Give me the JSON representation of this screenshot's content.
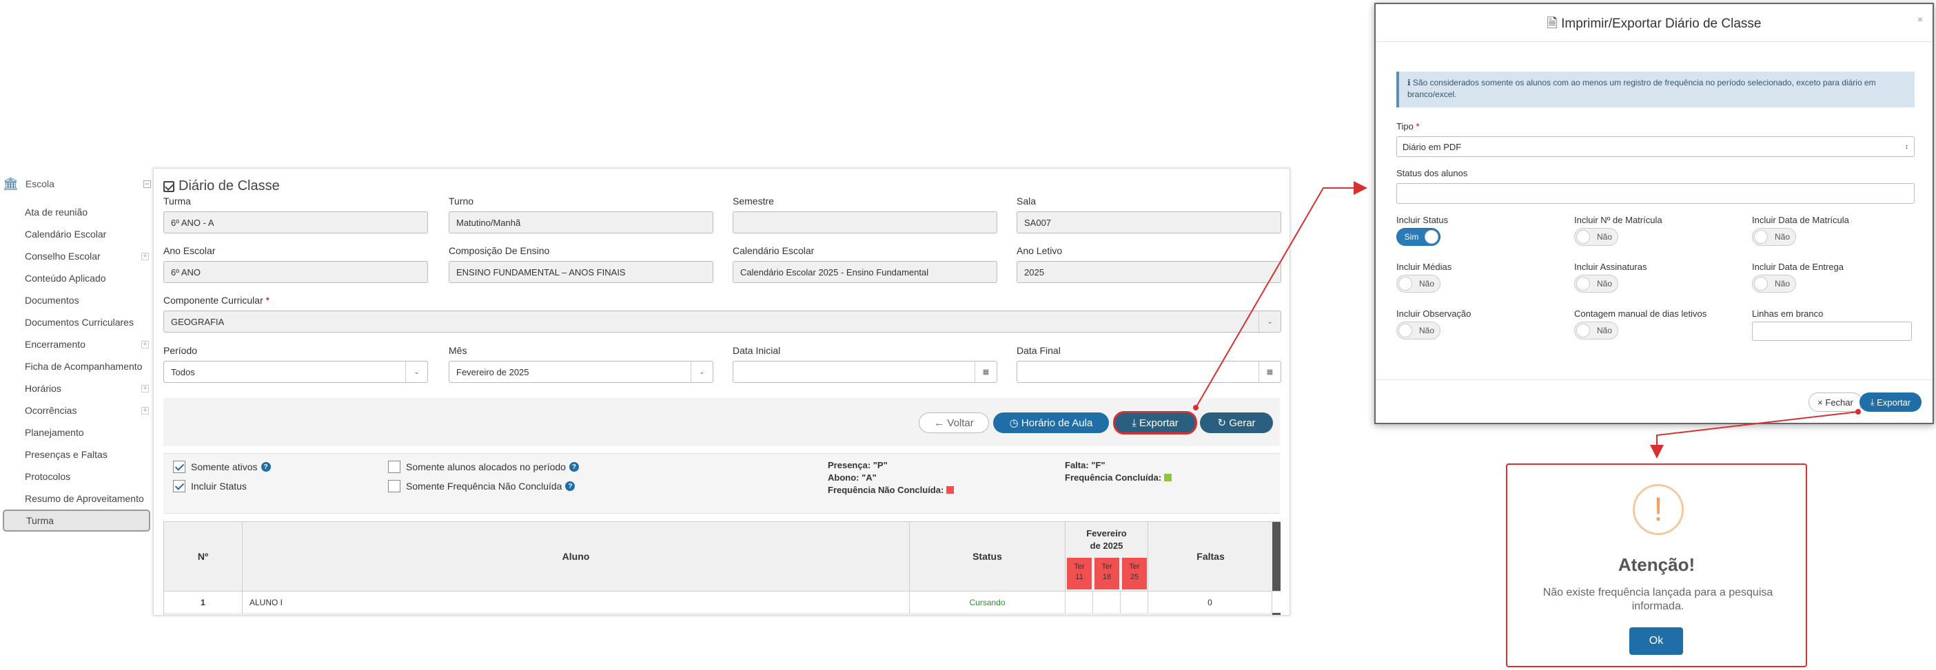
{
  "sidebar": {
    "header": "Escola",
    "items": [
      {
        "label": "Ata de reunião",
        "expandable": false
      },
      {
        "label": "Calendário Escolar",
        "expandable": false
      },
      {
        "label": "Conselho Escolar",
        "expandable": true
      },
      {
        "label": "Conteúdo Aplicado",
        "expandable": false
      },
      {
        "label": "Documentos",
        "expandable": false
      },
      {
        "label": "Documentos Curriculares",
        "expandable": false
      },
      {
        "label": "Encerramento",
        "expandable": true
      },
      {
        "label": "Ficha de Acompanhamento",
        "expandable": false
      },
      {
        "label": "Horários",
        "expandable": true
      },
      {
        "label": "Ocorrências",
        "expandable": true
      },
      {
        "label": "Planejamento",
        "expandable": false
      },
      {
        "label": "Presenças e Faltas",
        "expandable": false
      },
      {
        "label": "Protocolos",
        "expandable": false
      },
      {
        "label": "Resumo de Aproveitamento",
        "expandable": false
      },
      {
        "label": "Turma",
        "expandable": false,
        "active": true
      }
    ]
  },
  "panel": {
    "title": "Diário de Classe",
    "fields": {
      "turma": {
        "label": "Turma",
        "value": "6º ANO - A"
      },
      "turno": {
        "label": "Turno",
        "value": "Matutino/Manhã"
      },
      "semestre": {
        "label": "Semestre",
        "value": ""
      },
      "sala": {
        "label": "Sala",
        "value": "SA007"
      },
      "ano_escolar": {
        "label": "Ano Escolar",
        "value": "6º ANO"
      },
      "composicao": {
        "label": "Composição De Ensino",
        "value": "ENSINO FUNDAMENTAL – ANOS FINAIS"
      },
      "calendario": {
        "label": "Calendário Escolar",
        "value": "Calendário Escolar 2025 - Ensino Fundamental"
      },
      "ano_letivo": {
        "label": "Ano Letivo",
        "value": "2025"
      },
      "componente": {
        "label": "Componente Curricular",
        "value": "GEOGRAFIA",
        "required": "*"
      },
      "periodo": {
        "label": "Período",
        "value": "Todos"
      },
      "mes": {
        "label": "Mês",
        "value": "Fevereiro de 2025"
      },
      "data_inicial": {
        "label": "Data Inicial",
        "value": ""
      },
      "data_final": {
        "label": "Data Final",
        "value": ""
      }
    },
    "buttons": {
      "voltar": "Voltar",
      "horario": "Horário de Aula",
      "exportar": "Exportar",
      "gerar": "Gerar"
    },
    "filters": {
      "somente_ativos": {
        "label": "Somente ativos",
        "checked": true
      },
      "incluir_status": {
        "label": "Incluir Status",
        "checked": true
      },
      "somente_alocados": {
        "label": "Somente alunos alocados no período",
        "checked": false
      },
      "somente_nao_concluida": {
        "label": "Somente Frequência Não Concluída",
        "checked": false
      }
    },
    "legend": {
      "presenca": "Presença: \"P\"",
      "abono": "Abono: \"A\"",
      "nao_concluida": "Frequência Não Concluída:",
      "falta": "Falta: \"F\"",
      "concluida": "Frequência Concluída:",
      "colors": {
        "nao_concluida": "#f05050",
        "concluida": "#8cc63f"
      }
    },
    "table": {
      "headers": {
        "numero": "Nº",
        "aluno": "Aluno",
        "status": "Status",
        "mes": "Fevereiro de 2025",
        "faltas": "Faltas"
      },
      "days": [
        {
          "weekday": "Ter",
          "day": "11"
        },
        {
          "weekday": "Ter",
          "day": "18"
        },
        {
          "weekday": "Ter",
          "day": "25"
        }
      ],
      "rows": [
        {
          "numero": "1",
          "aluno": "ALUNO I",
          "status": "Cursando",
          "faltas": "0"
        }
      ]
    }
  },
  "modal": {
    "title": "Imprimir/Exportar Diário de Classe",
    "info": "São considerados somente os alunos com ao menos um registro de frequência no período selecionado, exceto para diário em branco/excel.",
    "tipo": {
      "label": "Tipo",
      "required": "*",
      "value": "Diário em PDF"
    },
    "status_alunos": {
      "label": "Status dos alunos",
      "value": ""
    },
    "toggles": [
      {
        "label": "Incluir Status",
        "value": "Sim",
        "on": true
      },
      {
        "label": "Incluir Nº de Matrícula",
        "value": "Não",
        "on": false
      },
      {
        "label": "Incluir Data de Matrícula",
        "value": "Não",
        "on": false
      },
      {
        "label": "Incluir Médias",
        "value": "Não",
        "on": false
      },
      {
        "label": "Incluir Assinaturas",
        "value": "Não",
        "on": false
      },
      {
        "label": "Incluir Data de Entrega",
        "value": "Não",
        "on": false
      },
      {
        "label": "Incluir Observação",
        "value": "Não",
        "on": false
      },
      {
        "label": "Contagem manual de dias letivos",
        "value": "Não",
        "on": false
      }
    ],
    "linhas_branco": {
      "label": "Linhas em branco",
      "value": ""
    },
    "fechar": "Fechar",
    "exportar": "Exportar"
  },
  "alert": {
    "title": "Atenção!",
    "message": "Não existe frequência lançada para a pesquisa informada.",
    "ok": "Ok"
  },
  "colors": {
    "primary": "#1f6ea8",
    "annotation": "#d83030",
    "warning": "#f0a060"
  }
}
